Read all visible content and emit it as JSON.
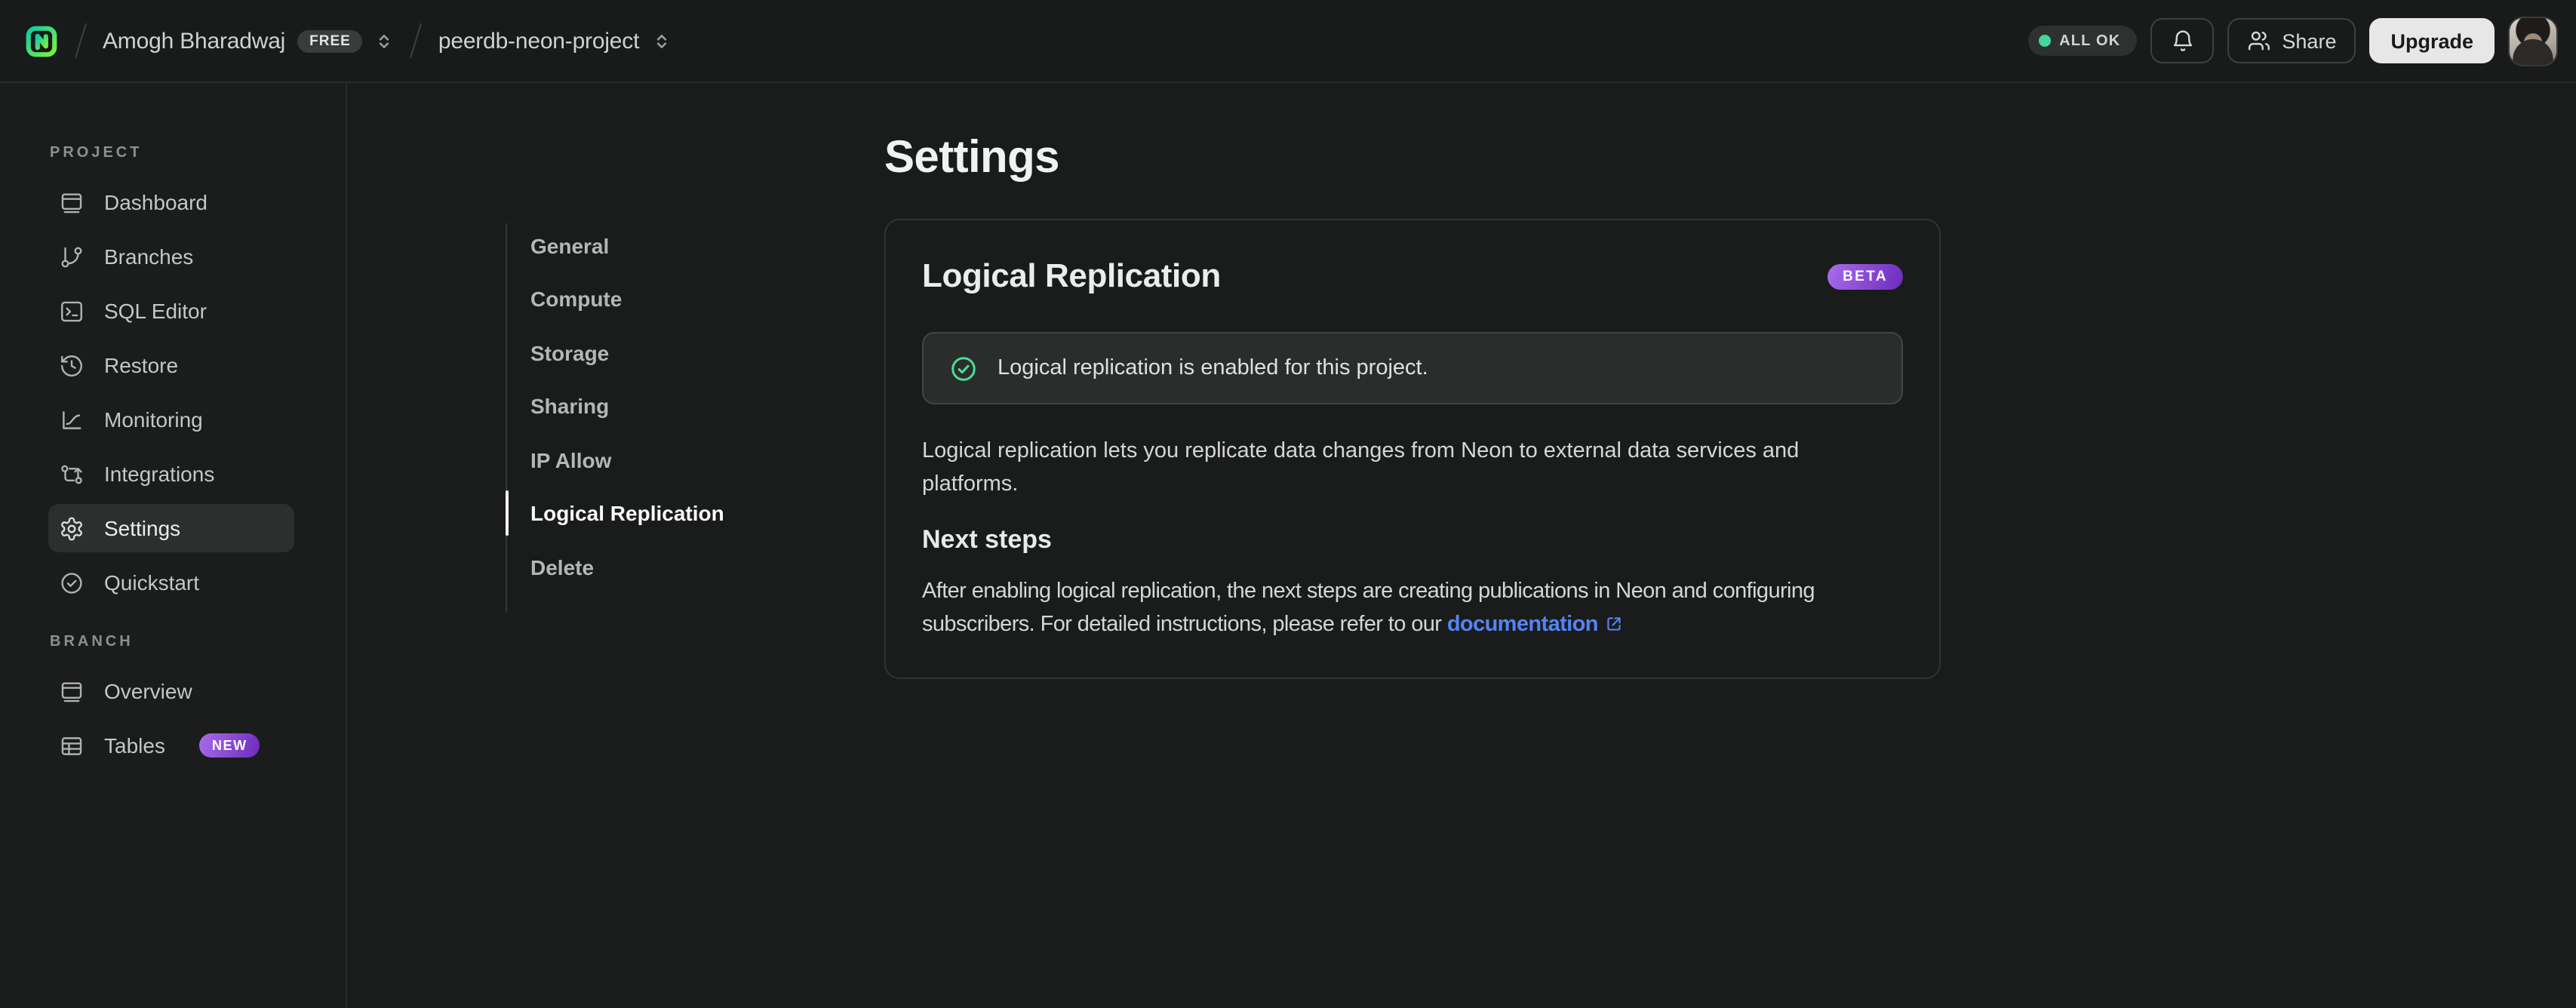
{
  "topbar": {
    "logo_icon": "neon-logo",
    "org": {
      "name": "Amogh Bharadwaj",
      "plan": "FREE",
      "selector_icon": "chevron-up-down-icon"
    },
    "project": {
      "name": "peerdb-neon-project",
      "selector_icon": "chevron-up-down-icon"
    },
    "status": {
      "label": "ALL OK",
      "dot_color": "#41d89a"
    },
    "notifications_icon": "bell-icon",
    "share": {
      "label": "Share",
      "icon": "users-icon"
    },
    "upgrade_label": "Upgrade",
    "avatar_icon": "user-avatar"
  },
  "sidebar": {
    "sections": [
      {
        "label": "PROJECT",
        "items": [
          {
            "label": "Dashboard",
            "icon": "dashboard-icon"
          },
          {
            "label": "Branches",
            "icon": "git-branch-icon"
          },
          {
            "label": "SQL Editor",
            "icon": "terminal-icon"
          },
          {
            "label": "Restore",
            "icon": "history-icon"
          },
          {
            "label": "Monitoring",
            "icon": "chart-icon"
          },
          {
            "label": "Integrations",
            "icon": "integrations-icon"
          },
          {
            "label": "Settings",
            "icon": "gear-icon"
          },
          {
            "label": "Quickstart",
            "icon": "check-circle-icon"
          }
        ]
      },
      {
        "label": "BRANCH",
        "items": [
          {
            "label": "Overview",
            "icon": "window-icon"
          },
          {
            "label": "Tables",
            "icon": "table-icon",
            "badge": "NEW"
          }
        ]
      }
    ]
  },
  "settings_nav": {
    "items": [
      {
        "label": "General"
      },
      {
        "label": "Compute"
      },
      {
        "label": "Storage"
      },
      {
        "label": "Sharing"
      },
      {
        "label": "IP Allow"
      },
      {
        "label": "Logical Replication"
      },
      {
        "label": "Delete"
      }
    ]
  },
  "main": {
    "page_title": "Settings",
    "card": {
      "title": "Logical Replication",
      "badge": "BETA",
      "alert_icon": "check-circle-icon",
      "alert_text": "Logical replication is enabled for this project.",
      "description": "Logical replication lets you replicate data changes from Neon to external data services and platforms.",
      "next_steps_title": "Next steps",
      "next_steps_text": "After enabling logical replication, the next steps are creating publications in Neon and configuring subscribers. For detailed instructions, please refer to our ",
      "doc_link_label": "documentation",
      "doc_link_icon": "external-link-icon"
    }
  },
  "colors": {
    "accent_green": "#41d89a",
    "badge_purple_start": "#a96cea",
    "badge_purple_end": "#6c2bbd",
    "link_blue": "#5483f6"
  }
}
